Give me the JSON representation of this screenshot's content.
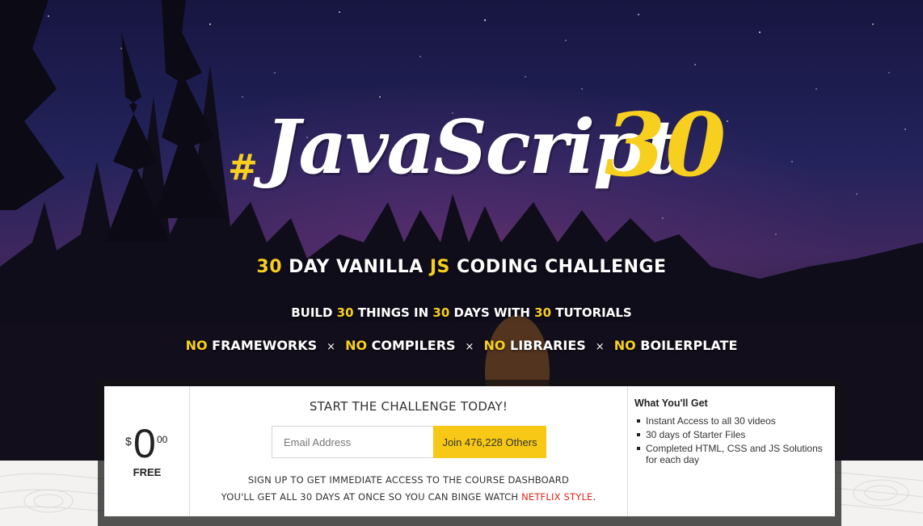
{
  "logo": {
    "hash": "#",
    "word": "JavaScript",
    "number": "30"
  },
  "tagline1": {
    "a": "30",
    "b": " DAY VANILLA ",
    "c": "JS",
    "d": " CODING CHALLENGE"
  },
  "tagline2": {
    "a": "BUILD ",
    "b": "30",
    "c": " THINGS IN ",
    "d": "30",
    "e": " DAYS WITH ",
    "f": "30",
    "g": " TUTORIALS"
  },
  "tagline3": {
    "items": [
      {
        "no": "NO",
        "text": " FRAMEWORKS"
      },
      {
        "no": "NO",
        "text": " COMPILERS"
      },
      {
        "no": "NO",
        "text": " LIBRARIES"
      },
      {
        "no": "NO",
        "text": " BOILERPLATE"
      }
    ],
    "separator": "×"
  },
  "price": {
    "currency": "$",
    "amount": "0",
    "cents": "00",
    "label": "FREE"
  },
  "signup": {
    "heading": "START THE CHALLENGE TODAY!",
    "email_placeholder": "Email Address",
    "button_label": "Join 476,228 Others",
    "info_line1": "SIGN UP TO GET IMMEDIATE ACCESS TO THE COURSE DASHBOARD",
    "info_line2_a": "YOU'LL GET ALL 30 DAYS AT ONCE SO YOU CAN BINGE WATCH ",
    "info_line2_b": "NETFLIX STYLE",
    "info_line2_c": "."
  },
  "what_you_get": {
    "title": "What You'll Get",
    "items": [
      "Instant Access to all 30 videos",
      "30 days of Starter Files",
      "Completed HTML, CSS and JS Solutions for each day"
    ]
  },
  "colors": {
    "accent": "#f7cf1f",
    "button": "#f7c815",
    "netflix_red": "#e2231a"
  }
}
